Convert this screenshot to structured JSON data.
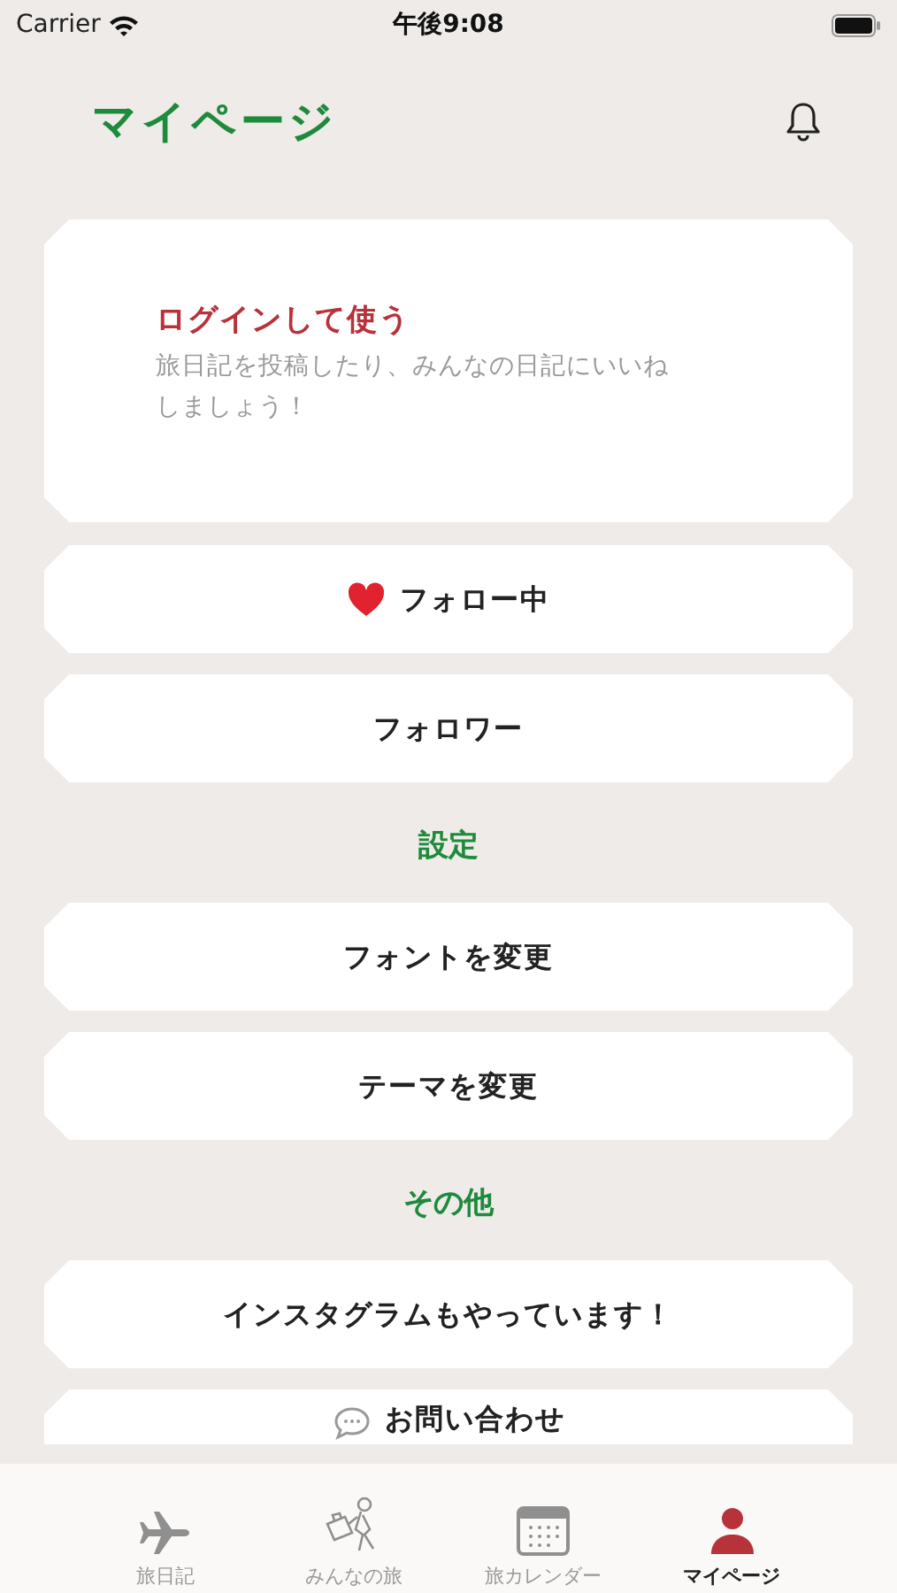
{
  "status_bar": {
    "carrier": "Carrier",
    "time": "午後9:08"
  },
  "header": {
    "title": "マイページ"
  },
  "login_card": {
    "title": "ログインして使う",
    "message": "旅日記を投稿したり、みんなの日記にいいねしましょう！"
  },
  "follow_buttons": [
    {
      "label": "フォロー中",
      "kind": "heart"
    },
    {
      "label": "フォロワー",
      "kind": "plain"
    }
  ],
  "sections": [
    {
      "title": "設定",
      "items": [
        {
          "label": "フォントを変更",
          "kind": "plain"
        },
        {
          "label": "テーマを変更",
          "kind": "plain"
        }
      ]
    },
    {
      "title": "その他",
      "items": [
        {
          "label": "インスタグラムもやっています！",
          "kind": "plain"
        },
        {
          "label": "お問い合わせ",
          "kind": "chat"
        }
      ]
    }
  ],
  "tab_bar": {
    "items": [
      {
        "label": "旅日記",
        "kind": "plane",
        "selected": false
      },
      {
        "label": "みんなの旅",
        "kind": "traveler",
        "selected": false
      },
      {
        "label": "旅カレンダー",
        "kind": "calendar",
        "selected": false
      },
      {
        "label": "マイページ",
        "kind": "person",
        "selected": true
      }
    ]
  }
}
